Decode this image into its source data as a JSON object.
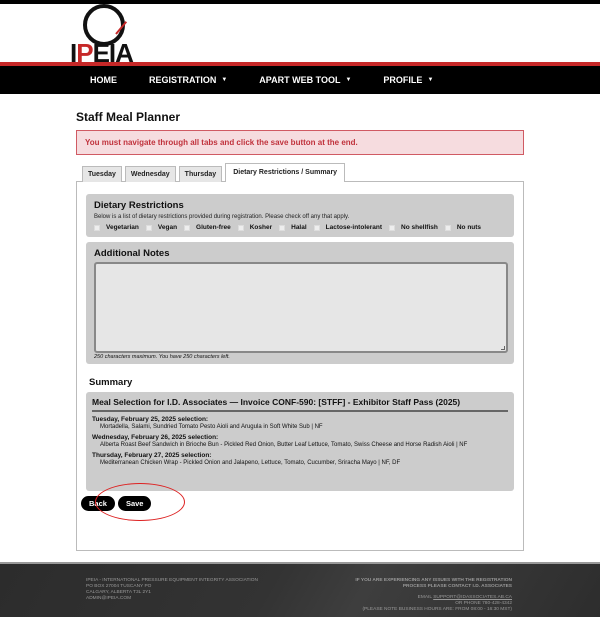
{
  "brand": {
    "logo_text_1": "I",
    "logo_text_p": "P",
    "logo_text_2": "EIA",
    "accent": "#c62828"
  },
  "nav": {
    "items": [
      {
        "label": "HOME",
        "has_caret": false
      },
      {
        "label": "REGISTRATION",
        "has_caret": true
      },
      {
        "label": "APART WEB TOOL",
        "has_caret": true
      },
      {
        "label": "PROFILE",
        "has_caret": true
      }
    ],
    "caret": "▼"
  },
  "page": {
    "title": "Staff Meal Planner",
    "alert": "You must navigate through all tabs and click the save button at the end."
  },
  "tabs": [
    {
      "label": "Tuesday",
      "active": false
    },
    {
      "label": "Wednesday",
      "active": false
    },
    {
      "label": "Thursday",
      "active": false
    },
    {
      "label": "Dietary Restrictions / Summary",
      "active": true
    }
  ],
  "dietary": {
    "title": "Dietary Restrictions",
    "description": "Below is a list of dietary restrictions provided during registration. Please check off any that apply.",
    "options": [
      {
        "label": "Vegetarian",
        "checked": false
      },
      {
        "label": "Vegan",
        "checked": false
      },
      {
        "label": "Gluten-free",
        "checked": false
      },
      {
        "label": "Kosher",
        "checked": false
      },
      {
        "label": "Halal",
        "checked": false
      },
      {
        "label": "Lactose-intolerant",
        "checked": false
      },
      {
        "label": "No shellfish",
        "checked": false
      },
      {
        "label": "No nuts",
        "checked": false
      }
    ]
  },
  "notes": {
    "title": "Additional Notes",
    "value": "",
    "hint": "250 characters maximum. You have 250 characters left."
  },
  "summary": {
    "title": "Summary",
    "heading": "Meal Selection for I.D. Associates — Invoice CONF-590: [STFF] - Exhibitor Staff Pass (2025)",
    "days": [
      {
        "label": "Tuesday, February 25, 2025 selection:",
        "selection": "Mortadella, Salami, Sundried Tomato Pesto Aioli and Arugula in Soft White Sub | NF"
      },
      {
        "label": "Wednesday, February 26, 2025 selection:",
        "selection": "Alberta Roast Beef Sandwich in Brioche Bun - Pickled Red Onion, Butter Leaf Lettuce, Tomato, Swiss Cheese and Horse Radish Aioli | NF"
      },
      {
        "label": "Thursday, February 27, 2025 selection:",
        "selection": "Mediterranean Chicken Wrap - Pickled Onion and Jalapeno, Lettuce, Tomato, Cucumber, Sriracha Mayo | NF, DF"
      }
    ]
  },
  "buttons": {
    "back": "Back",
    "save": "Save"
  },
  "footer": {
    "left": [
      "IPEIA - INTERNATIONAL PRESSURE EQUIPMENT INTEGRITY ASSOCIATION",
      "PO BOX 27004 TUSCANY PO",
      "CALGARY, ALBERTA T3L 2Y1",
      "ADMIN@IPEIA.COM"
    ],
    "right_notice_1": "IF YOU ARE EXPERIENCING ANY ISSUES WITH THE REGISTRATION",
    "right_notice_2": "PROCESS PLEASE CONTACT I.D. ASSOCIATES",
    "email_label": "EMAIL",
    "email": "SUPPORT@IDASSOCIATES.AB.CA",
    "phone": "OR PHONE 780-428-4342",
    "hours": "(PLEASE NOTE BUSINESS HOURS ARE: FROM 08:00 - 16:30 MST)"
  }
}
